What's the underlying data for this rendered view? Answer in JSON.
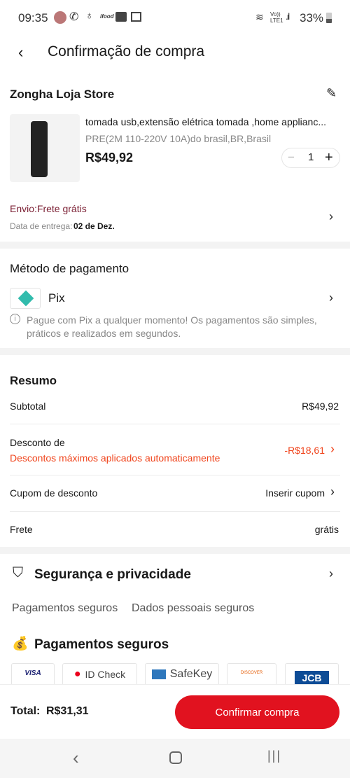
{
  "status_bar": {
    "time": "09:35",
    "battery": "33%",
    "network": "Vo)) LTE1"
  },
  "header": {
    "title": "Confirmação de compra"
  },
  "store": {
    "name": "Zongha Loja Store"
  },
  "product": {
    "title": "tomada usb,extensão elétrica tomada ,home applianc...",
    "variant": "PRE(2M 110-220V 10A)do brasil,BR,Brasil",
    "price": "R$49,92",
    "quantity": "1"
  },
  "shipping": {
    "label": "Envio:Frete grátis",
    "date_label": "Data de entrega:",
    "date": "02 de Dez."
  },
  "payment": {
    "heading": "Método de pagamento",
    "method": "Pix",
    "info": "Pague com Pix a qualquer momento! Os pagamentos são simples, práticos e realizados em segundos."
  },
  "summary": {
    "heading": "Resumo",
    "subtotal_label": "Subtotal",
    "subtotal": "R$49,92",
    "discount_label": "Desconto de",
    "discount_note": "Descontos máximos aplicados automaticamente",
    "discount": "-R$18,61",
    "coupon_label": "Cupom de desconto",
    "coupon_action": "Inserir cupom",
    "shipping_label": "Frete",
    "shipping_value": "grátis"
  },
  "security": {
    "heading": "Segurança e privacidade",
    "tabs": [
      "Pagamentos seguros",
      "Dados pessoais seguros"
    ],
    "sub_heading": "Pagamentos seguros",
    "cards": [
      "VISA",
      "ID Check",
      "SafeKey",
      "DISCOVER",
      "JCB"
    ]
  },
  "footer": {
    "total_label": "Total:",
    "total": "R$31,31",
    "confirm": "Confirmar compra"
  },
  "colors": {
    "accent": "#e1121f",
    "discount": "#f0441c",
    "shipping": "#7b1f33"
  }
}
